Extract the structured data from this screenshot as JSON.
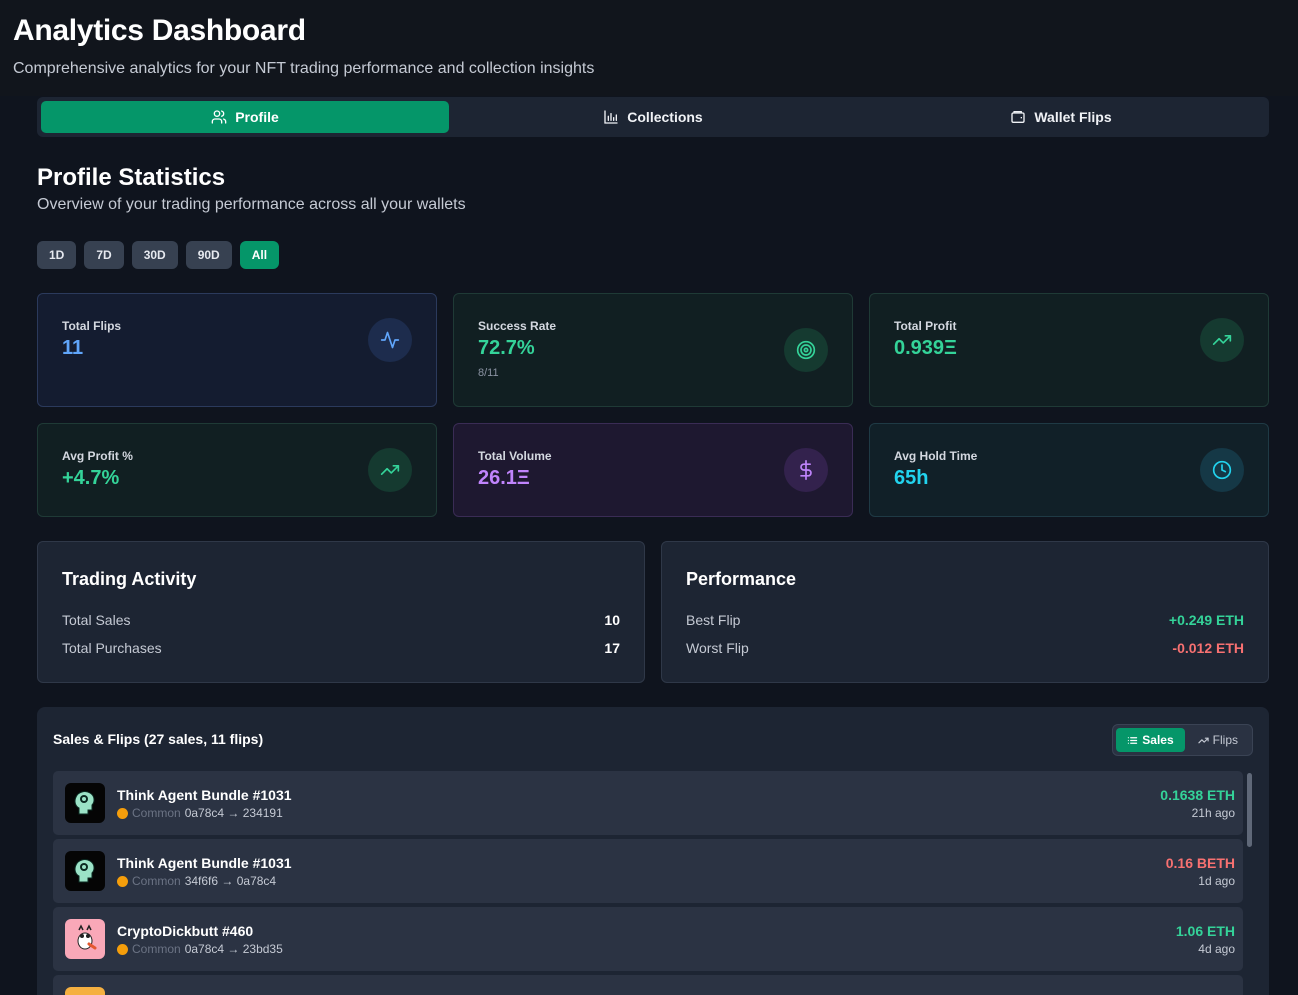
{
  "header": {
    "title": "Analytics Dashboard",
    "subtitle": "Comprehensive analytics for your NFT trading performance and collection insights"
  },
  "tabs": [
    {
      "label": "Profile",
      "icon": "users-icon",
      "active": true
    },
    {
      "label": "Collections",
      "icon": "bar-chart-icon",
      "active": false
    },
    {
      "label": "Wallet Flips",
      "icon": "wallet-icon",
      "active": false
    }
  ],
  "profile": {
    "title": "Profile Statistics",
    "subtitle": "Overview of your trading performance across all your wallets"
  },
  "ranges": [
    "1D",
    "7D",
    "30D",
    "90D",
    "All"
  ],
  "active_range": "All",
  "stats": [
    {
      "label": "Total Flips",
      "value": "11",
      "sub": "",
      "icon": "activity-icon",
      "color": "#60a5fa"
    },
    {
      "label": "Success Rate",
      "value": "72.7%",
      "sub": "8/11",
      "icon": "target-icon",
      "color": "#34d399"
    },
    {
      "label": "Total Profit",
      "value": "0.939Ξ",
      "sub": "",
      "icon": "trending-up-icon",
      "color": "#34d399"
    },
    {
      "label": "Avg Profit %",
      "value": "+4.7%",
      "sub": "",
      "icon": "trending-up-icon",
      "color": "#34d399"
    },
    {
      "label": "Total Volume",
      "value": "26.1Ξ",
      "sub": "",
      "icon": "dollar-icon",
      "color": "#c084fc"
    },
    {
      "label": "Avg Hold Time",
      "value": "65h",
      "sub": "",
      "icon": "clock-icon",
      "color": "#22d3ee"
    }
  ],
  "trading_activity": {
    "title": "Trading Activity",
    "rows": [
      {
        "label": "Total Sales",
        "value": "10"
      },
      {
        "label": "Total Purchases",
        "value": "17"
      }
    ]
  },
  "performance": {
    "title": "Performance",
    "rows": [
      {
        "label": "Best Flip",
        "value": "+0.249 ETH",
        "color": "#34d399"
      },
      {
        "label": "Worst Flip",
        "value": "-0.012 ETH",
        "color": "#f87171"
      }
    ]
  },
  "sales": {
    "title": "Sales & Flips (27 sales, 11 flips)",
    "toggle": [
      {
        "label": "Sales",
        "icon": "list-icon",
        "active": true
      },
      {
        "label": "Flips",
        "icon": "trending-up-icon",
        "active": false
      }
    ],
    "items": [
      {
        "name": "Think Agent Bundle #1031",
        "rarity": "Common",
        "route": "0a78c4 → 234191",
        "price": "0.1638 ETH",
        "price_color": "#34d399",
        "time": "21h ago",
        "thumb": "brain-head-icon"
      },
      {
        "name": "Think Agent Bundle #1031",
        "rarity": "Common",
        "route": "34f6f6 → 0a78c4",
        "price": "0.16 BETH",
        "price_color": "#f87171",
        "time": "1d ago",
        "thumb": "brain-head-icon"
      },
      {
        "name": "CryptoDickbutt #460",
        "rarity": "Common",
        "route": "0a78c4 → 23bd35",
        "price": "1.06 ETH",
        "price_color": "#34d399",
        "time": "4d ago",
        "thumb": "dickbutt-icon"
      }
    ]
  }
}
